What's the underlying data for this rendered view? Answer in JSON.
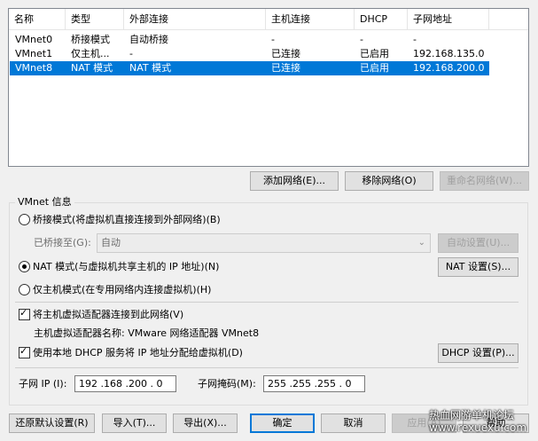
{
  "table": {
    "columns": [
      "名称",
      "类型",
      "外部连接",
      "主机连接",
      "DHCP",
      "子网地址"
    ],
    "rows": [
      {
        "name": "VMnet0",
        "type": "桥接模式",
        "external": "自动桥接",
        "host": "-",
        "dhcp": "-",
        "subnet": "-"
      },
      {
        "name": "VMnet1",
        "type": "仅主机...",
        "external": "-",
        "host": "已连接",
        "dhcp": "已启用",
        "subnet": "192.168.135.0"
      },
      {
        "name": "VMnet8",
        "type": "NAT 模式",
        "external": "NAT 模式",
        "host": "已连接",
        "dhcp": "已启用",
        "subnet": "192.168.200.0"
      }
    ],
    "selected_row": "VMnet8"
  },
  "table_buttons": {
    "add": "添加网络(E)...",
    "remove": "移除网络(O)",
    "rename": "重命名网络(W)..."
  },
  "vmnet_info": {
    "title": "VMnet 信息",
    "bridged": "桥接模式(将虚拟机直接连接到外部网络)(B)",
    "bridged_to_label": "已桥接至(G):",
    "bridged_to_value": "自动",
    "auto_settings": "自动设置(U)...",
    "nat": "NAT 模式(与虚拟机共享主机的 IP 地址)(N)",
    "nat_settings": "NAT 设置(S)...",
    "host_only": "仅主机模式(在专用网络内连接虚拟机)(H)",
    "selected_mode": "nat",
    "connect_adapter": "将主机虚拟适配器连接到此网络(V)",
    "connect_adapter_checked": true,
    "adapter_name": "主机虚拟适配器名称: VMware 网络适配器 VMnet8",
    "use_dhcp": "使用本地 DHCP 服务将 IP 地址分配给虚拟机(D)",
    "use_dhcp_checked": true,
    "dhcp_settings": "DHCP 设置(P)...",
    "subnet_ip_label": "子网 IP (I):",
    "subnet_ip": "192 .168 .200 . 0",
    "subnet_mask_label": "子网掩码(M):",
    "subnet_mask": "255 .255 .255 . 0"
  },
  "footer": {
    "restore": "还原默认设置(R)",
    "import": "导入(T)...",
    "export": "导出(X)...",
    "ok": "确定",
    "cancel": "取消",
    "apply": "应用(A)",
    "help": "帮助"
  },
  "watermark": {
    "line1": "热血网游单机论坛",
    "line2": "www.rexuexu.com"
  }
}
